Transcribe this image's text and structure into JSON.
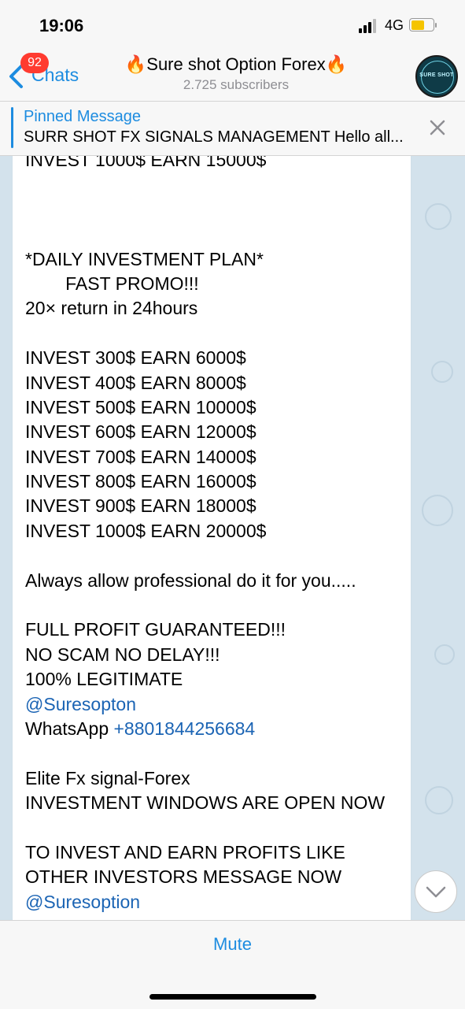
{
  "status_bar": {
    "time": "19:06",
    "network": "4G"
  },
  "nav": {
    "back_label": "Chats",
    "unread_badge": "92",
    "title": "Sure shot Option Forex",
    "title_emoji": "🔥",
    "subscribers": "2.725 subscribers",
    "avatar_text": "SURE SHOT"
  },
  "pinned": {
    "title": "Pinned Message",
    "text": "SURR SHOT FX SIGNALS MANAGEMENT Hello all..."
  },
  "message": {
    "lines": [
      {
        "text": "INVEST 1000$ EARN 15000$"
      },
      {
        "text": ""
      },
      {
        "text": ""
      },
      {
        "text": ""
      },
      {
        "text": "*DAILY INVESTMENT PLAN*"
      },
      {
        "text": "        FAST PROMO!!!"
      },
      {
        "text": "20× return in 24hours"
      },
      {
        "text": ""
      },
      {
        "text": "INVEST 300$ EARN 6000$"
      },
      {
        "text": "INVEST 400$ EARN 8000$"
      },
      {
        "text": "INVEST 500$ EARN 10000$"
      },
      {
        "text": "INVEST 600$ EARN 12000$"
      },
      {
        "text": "INVEST 700$ EARN 14000$"
      },
      {
        "text": "INVEST 800$ EARN 16000$"
      },
      {
        "text": "INVEST 900$ EARN 18000$"
      },
      {
        "text": "INVEST 1000$ EARN 20000$"
      },
      {
        "text": ""
      },
      {
        "text": "Always allow professional do it for you....."
      },
      {
        "text": ""
      },
      {
        "text": "FULL PROFIT GUARANTEED!!!"
      },
      {
        "text": "NO SCAM NO DELAY!!!"
      },
      {
        "text": "100% LEGITIMATE"
      },
      {
        "text": "",
        "link": "@Suresopton"
      },
      {
        "text": "WhatsApp ",
        "link": "+8801844256684"
      },
      {
        "text": ""
      },
      {
        "text": "Elite Fx signal-Forex"
      },
      {
        "text": "INVESTMENT WINDOWS ARE OPEN NOW"
      },
      {
        "text": ""
      },
      {
        "text": "TO INVEST AND EARN PROFITS LIKE"
      },
      {
        "text": "OTHER INVESTORS MESSAGE NOW"
      },
      {
        "text": "",
        "link": "@Suresoption"
      }
    ]
  },
  "bottom": {
    "mute_label": "Mute"
  },
  "colors": {
    "accent": "#1d8ce0",
    "link": "#1b64b4",
    "badge": "#ff3b30",
    "chat_bg": "#d3e2ec"
  },
  "icons": {
    "back": "chevron-left-icon",
    "close": "close-icon",
    "scroll": "chevron-down-icon",
    "signal": "signal-icon",
    "battery": "battery-icon"
  }
}
